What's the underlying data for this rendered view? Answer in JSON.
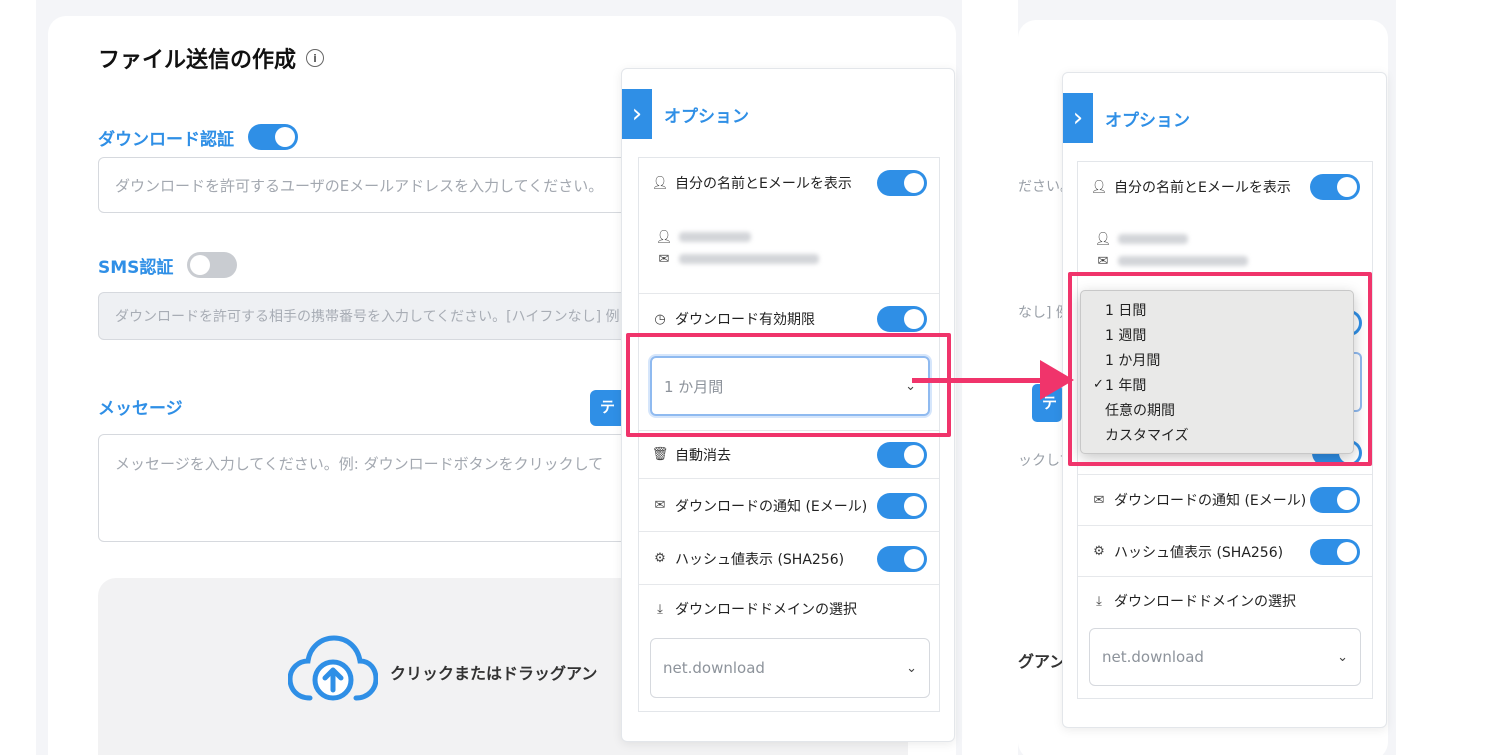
{
  "form": {
    "title": "ファイル送信の作成",
    "info_icon": "ⓘ",
    "download_auth": {
      "label": "ダウンロード認証",
      "enabled": true,
      "placeholder": "ダウンロードを許可するユーザのEメールアドレスを入力してください。"
    },
    "sms_auth": {
      "label": "SMS認証",
      "enabled": false,
      "placeholder": "ダウンロードを許可する相手の携帯番号を入力してください。[ハイフンなし] 例:"
    },
    "message": {
      "label": "メッセージ",
      "template_button": "テ",
      "placeholder": "メッセージを入力してください。例: ダウンロードボタンをクリックして"
    },
    "upload": {
      "icon": "cloud-upload-icon",
      "text": "クリックまたはドラッグアン"
    }
  },
  "right_fragments": {
    "email_tail": "ださい。",
    "sms_tail": "なし] 例",
    "message_tail": "ックして",
    "template_frag": "テ",
    "upload_tail": "グアン"
  },
  "options_panel": {
    "title": "オプション",
    "show_name_email": {
      "label": "自分の名前とEメールを表示",
      "enabled": true
    },
    "expiry": {
      "label": "ダウンロード有効期限",
      "enabled": true,
      "selected": "1 か月間"
    },
    "auto_delete": {
      "label": "自動消去",
      "enabled": true
    },
    "notify": {
      "label": "ダウンロードの通知 (Eメール)",
      "enabled": true
    },
    "hash": {
      "label": "ハッシュ値表示 (SHA256)",
      "enabled": true
    },
    "domain": {
      "label": "ダウンロードドメインの選択",
      "selected": "net.download"
    }
  },
  "expiry_menu": {
    "options": [
      "1 日間",
      "1 週間",
      "1 か月間",
      "1 年間",
      "任意の期間",
      "カスタマイズ"
    ],
    "checked_index": 3,
    "check_mark": "✓"
  },
  "colors": {
    "accent": "#2f8fe6",
    "highlight": "#f0346b"
  }
}
